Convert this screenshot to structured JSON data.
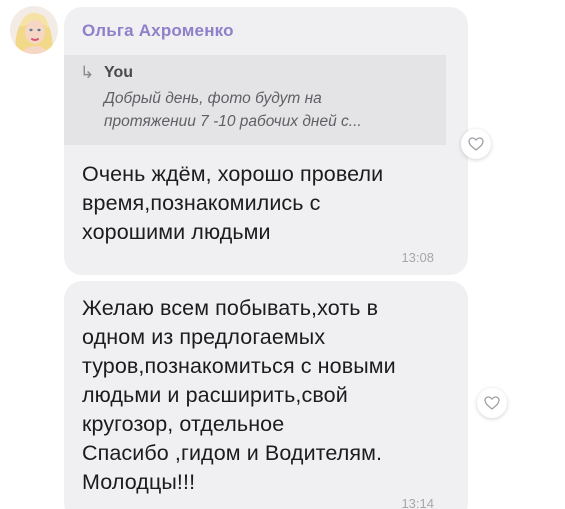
{
  "messages": [
    {
      "sender": "Ольга Ахроменко",
      "reply": {
        "author": "You",
        "line1": "Добрый день, фото будут на",
        "line2": "протяжении 7 -10 рабочих дней с..."
      },
      "lines": [
        "Очень ждём, хорошо провели",
        "время,познакомились с",
        "хорошими людьми"
      ],
      "time": "13:08"
    },
    {
      "lines": [
        "Желаю всем побывать,хоть в",
        "одном из предлогаемых",
        "туров,познакомиться с новыми",
        "людьми и расширить,свой",
        "кругозор, отдельное",
        "Спасибо ,гидом и Водителям.",
        "Молодцы!!!"
      ],
      "time": "13:14"
    }
  ],
  "icons": {
    "reply": "reply-arrow-icon",
    "like": "heart-outline-icon"
  },
  "colors": {
    "sender_name": "#8f80c9",
    "bubble_bg": "#f0f0f2",
    "reply_bg": "#e4e4e7",
    "time": "#a7a7ab"
  }
}
